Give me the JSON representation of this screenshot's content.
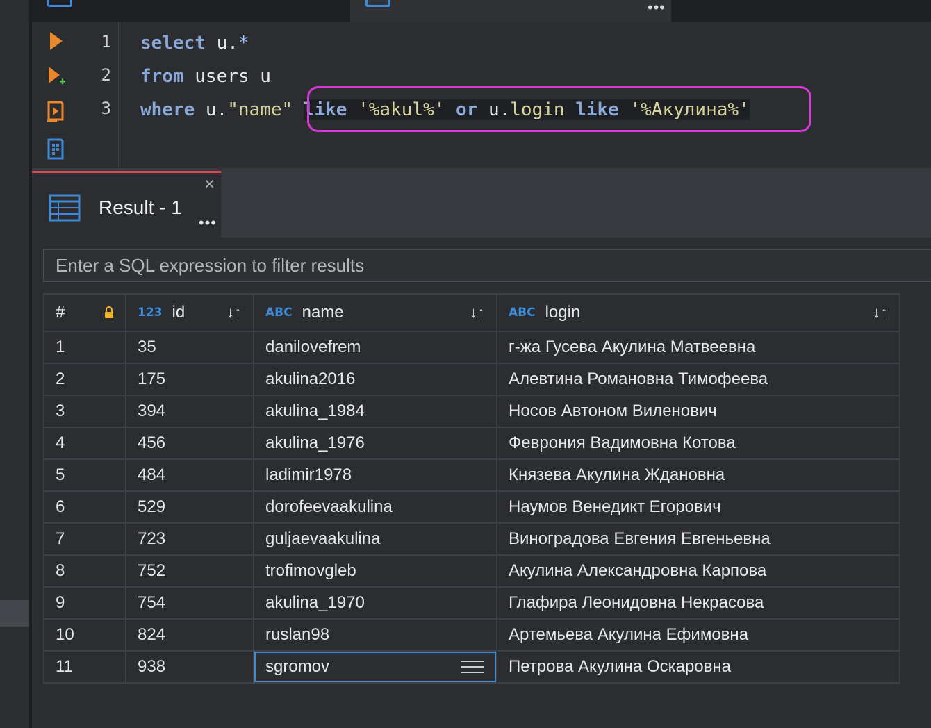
{
  "editor": {
    "line_numbers": [
      "1",
      "2",
      "3"
    ],
    "lines": [
      [
        {
          "t": "select",
          "c": "kw"
        },
        {
          "t": " u.",
          "c": "id"
        },
        {
          "t": "*",
          "c": "op"
        }
      ],
      [
        {
          "t": "from",
          "c": "kw"
        },
        {
          "t": " users u",
          "c": "id"
        }
      ],
      [
        {
          "t": "where",
          "c": "kw"
        },
        {
          "t": " u.",
          "c": "id"
        },
        {
          "t": "\"name\"",
          "c": "fld"
        },
        {
          "t": " ",
          "c": "id"
        },
        {
          "t": "like",
          "c": "kw hlbg"
        },
        {
          "t": " ",
          "c": "id hlbg"
        },
        {
          "t": "'%akul%'",
          "c": "str hlbg"
        },
        {
          "t": " ",
          "c": "id hlbg"
        },
        {
          "t": "or",
          "c": "kw hlbg"
        },
        {
          "t": " u.",
          "c": "id hlbg"
        },
        {
          "t": "login",
          "c": "fld hlbg"
        },
        {
          "t": " ",
          "c": "id hlbg"
        },
        {
          "t": "like",
          "c": "kw hlbg"
        },
        {
          "t": " ",
          "c": "id hlbg"
        },
        {
          "t": "'%Акулина%'",
          "c": "str hlbg"
        }
      ]
    ]
  },
  "results": {
    "tab_label": "Result - 1",
    "filter_placeholder": "Enter a SQL expression to filter results",
    "columns": [
      {
        "label": "#",
        "type": ""
      },
      {
        "label": "id",
        "type": "123"
      },
      {
        "label": "name",
        "type": "ABC"
      },
      {
        "label": "login",
        "type": "ABC"
      }
    ],
    "rows": [
      [
        "1",
        "35",
        "danilovefrem",
        "г-жа Гусева Акулина Матвеевна"
      ],
      [
        "2",
        "175",
        "akulina2016",
        "Алевтина Романовна Тимофеева"
      ],
      [
        "3",
        "394",
        "akulina_1984",
        "Носов Автоном Виленович"
      ],
      [
        "4",
        "456",
        "akulina_1976",
        "Феврония Вадимовна Котова"
      ],
      [
        "5",
        "484",
        "ladimir1978",
        "Князева Акулина Ждановна"
      ],
      [
        "6",
        "529",
        "dorofeevaakulina",
        "Наумов Венедикт Егорович"
      ],
      [
        "7",
        "723",
        "guljaevaakulina",
        "Виноградова Евгения Евгеньевна"
      ],
      [
        "8",
        "752",
        "trofimovgleb",
        "Акулина Александровна Карпова"
      ],
      [
        "9",
        "754",
        "akulina_1970",
        "Глафира Леонидовна Некрасова"
      ],
      [
        "10",
        "824",
        "ruslan98",
        "Артемьева Акулина Ефимовна"
      ],
      [
        "11",
        "938",
        "sgromov",
        "Петрова Акулина Оскаровна"
      ]
    ]
  }
}
